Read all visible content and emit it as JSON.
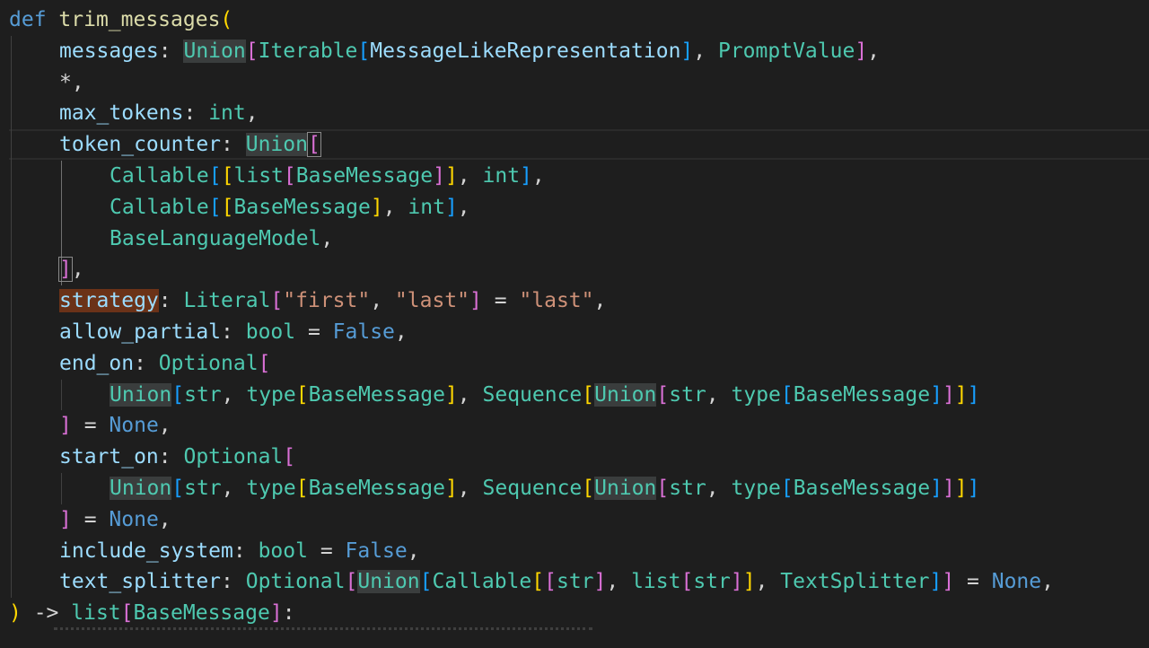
{
  "colors": {
    "background": "#1e1e1e",
    "default": "#d4d4d4",
    "keyword": "#569cd6",
    "function": "#dcdcaa",
    "param": "#9cdcfe",
    "type": "#4ec9b0",
    "string": "#ce9178",
    "bracket_yellow": "#ffd700",
    "bracket_pink": "#da70d6",
    "bracket_blue": "#179fff"
  },
  "code_lines": [
    {
      "indent": 0,
      "tokens": [
        {
          "t": "def",
          "c": "keyword"
        },
        {
          "t": " ",
          "c": "default"
        },
        {
          "t": "trim_messages",
          "c": "function"
        },
        {
          "t": "(",
          "c": "bracket_yellow"
        }
      ]
    },
    {
      "indent": 1,
      "tokens": [
        {
          "t": "messages",
          "c": "param"
        },
        {
          "t": ": ",
          "c": "default"
        },
        {
          "t": "Union",
          "c": "type",
          "hl": "hl"
        },
        {
          "t": "[",
          "c": "bracket_pink"
        },
        {
          "t": "Iterable",
          "c": "type"
        },
        {
          "t": "[",
          "c": "bracket_blue"
        },
        {
          "t": "MessageLikeRepresentation",
          "c": "param"
        },
        {
          "t": "]",
          "c": "bracket_blue"
        },
        {
          "t": ", ",
          "c": "default"
        },
        {
          "t": "PromptValue",
          "c": "type"
        },
        {
          "t": "]",
          "c": "bracket_pink"
        },
        {
          "t": ",",
          "c": "default"
        }
      ]
    },
    {
      "indent": 1,
      "tokens": [
        {
          "t": "*,",
          "c": "default"
        }
      ]
    },
    {
      "indent": 1,
      "tokens": [
        {
          "t": "max_tokens",
          "c": "param"
        },
        {
          "t": ": ",
          "c": "default"
        },
        {
          "t": "int",
          "c": "type"
        },
        {
          "t": ",",
          "c": "default"
        }
      ]
    },
    {
      "indent": 1,
      "tokens": [
        {
          "t": "token_counter",
          "c": "param"
        },
        {
          "t": ": ",
          "c": "default"
        },
        {
          "t": "Union",
          "c": "type",
          "hl": "hl"
        },
        {
          "t": "[",
          "c": "bracket_pink",
          "hl": "bracket-match"
        }
      ]
    },
    {
      "indent": 2,
      "tokens": [
        {
          "t": "Callable",
          "c": "type"
        },
        {
          "t": "[",
          "c": "bracket_blue"
        },
        {
          "t": "[",
          "c": "bracket_yellow"
        },
        {
          "t": "list",
          "c": "type"
        },
        {
          "t": "[",
          "c": "bracket_pink"
        },
        {
          "t": "BaseMessage",
          "c": "type"
        },
        {
          "t": "]",
          "c": "bracket_pink"
        },
        {
          "t": "]",
          "c": "bracket_yellow"
        },
        {
          "t": ", ",
          "c": "default"
        },
        {
          "t": "int",
          "c": "type"
        },
        {
          "t": "]",
          "c": "bracket_blue"
        },
        {
          "t": ",",
          "c": "default"
        }
      ]
    },
    {
      "indent": 2,
      "tokens": [
        {
          "t": "Callable",
          "c": "type"
        },
        {
          "t": "[",
          "c": "bracket_blue"
        },
        {
          "t": "[",
          "c": "bracket_yellow"
        },
        {
          "t": "BaseMessage",
          "c": "type"
        },
        {
          "t": "]",
          "c": "bracket_yellow"
        },
        {
          "t": ", ",
          "c": "default"
        },
        {
          "t": "int",
          "c": "type"
        },
        {
          "t": "]",
          "c": "bracket_blue"
        },
        {
          "t": ",",
          "c": "default"
        }
      ]
    },
    {
      "indent": 2,
      "tokens": [
        {
          "t": "BaseLanguageModel",
          "c": "type"
        },
        {
          "t": ",",
          "c": "default"
        }
      ]
    },
    {
      "indent": 1,
      "tokens": [
        {
          "t": "]",
          "c": "bracket_pink",
          "hl": "bracket-match"
        },
        {
          "t": ",",
          "c": "default"
        }
      ]
    },
    {
      "indent": 1,
      "tokens": [
        {
          "t": "strategy",
          "c": "param",
          "hl": "hl-warn"
        },
        {
          "t": ": ",
          "c": "default"
        },
        {
          "t": "Literal",
          "c": "type"
        },
        {
          "t": "[",
          "c": "bracket_pink"
        },
        {
          "t": "\"first\"",
          "c": "string"
        },
        {
          "t": ", ",
          "c": "default"
        },
        {
          "t": "\"last\"",
          "c": "string"
        },
        {
          "t": "]",
          "c": "bracket_pink"
        },
        {
          "t": " = ",
          "c": "default"
        },
        {
          "t": "\"last\"",
          "c": "string"
        },
        {
          "t": ",",
          "c": "default"
        }
      ]
    },
    {
      "indent": 1,
      "tokens": [
        {
          "t": "allow_partial",
          "c": "param"
        },
        {
          "t": ": ",
          "c": "default"
        },
        {
          "t": "bool",
          "c": "type"
        },
        {
          "t": " = ",
          "c": "default"
        },
        {
          "t": "False",
          "c": "keyword"
        },
        {
          "t": ",",
          "c": "default"
        }
      ]
    },
    {
      "indent": 1,
      "tokens": [
        {
          "t": "end_on",
          "c": "param"
        },
        {
          "t": ": ",
          "c": "default"
        },
        {
          "t": "Optional",
          "c": "type"
        },
        {
          "t": "[",
          "c": "bracket_pink"
        }
      ]
    },
    {
      "indent": 2,
      "tokens": [
        {
          "t": "Union",
          "c": "type",
          "hl": "hl"
        },
        {
          "t": "[",
          "c": "bracket_blue"
        },
        {
          "t": "str",
          "c": "type"
        },
        {
          "t": ", ",
          "c": "default"
        },
        {
          "t": "type",
          "c": "type"
        },
        {
          "t": "[",
          "c": "bracket_yellow"
        },
        {
          "t": "BaseMessage",
          "c": "type"
        },
        {
          "t": "]",
          "c": "bracket_yellow"
        },
        {
          "t": ", ",
          "c": "default"
        },
        {
          "t": "Sequence",
          "c": "type"
        },
        {
          "t": "[",
          "c": "bracket_yellow"
        },
        {
          "t": "Union",
          "c": "type",
          "hl": "hl"
        },
        {
          "t": "[",
          "c": "bracket_pink"
        },
        {
          "t": "str",
          "c": "type"
        },
        {
          "t": ", ",
          "c": "default"
        },
        {
          "t": "type",
          "c": "type"
        },
        {
          "t": "[",
          "c": "bracket_blue"
        },
        {
          "t": "BaseMessage",
          "c": "type"
        },
        {
          "t": "]",
          "c": "bracket_blue"
        },
        {
          "t": "]",
          "c": "bracket_pink"
        },
        {
          "t": "]",
          "c": "bracket_yellow"
        },
        {
          "t": "]",
          "c": "bracket_blue"
        }
      ]
    },
    {
      "indent": 1,
      "tokens": [
        {
          "t": "]",
          "c": "bracket_pink"
        },
        {
          "t": " = ",
          "c": "default"
        },
        {
          "t": "None",
          "c": "keyword"
        },
        {
          "t": ",",
          "c": "default"
        }
      ]
    },
    {
      "indent": 1,
      "tokens": [
        {
          "t": "start_on",
          "c": "param"
        },
        {
          "t": ": ",
          "c": "default"
        },
        {
          "t": "Optional",
          "c": "type"
        },
        {
          "t": "[",
          "c": "bracket_pink"
        }
      ]
    },
    {
      "indent": 2,
      "tokens": [
        {
          "t": "Union",
          "c": "type",
          "hl": "hl"
        },
        {
          "t": "[",
          "c": "bracket_blue"
        },
        {
          "t": "str",
          "c": "type"
        },
        {
          "t": ", ",
          "c": "default"
        },
        {
          "t": "type",
          "c": "type"
        },
        {
          "t": "[",
          "c": "bracket_yellow"
        },
        {
          "t": "BaseMessage",
          "c": "type"
        },
        {
          "t": "]",
          "c": "bracket_yellow"
        },
        {
          "t": ", ",
          "c": "default"
        },
        {
          "t": "Sequence",
          "c": "type"
        },
        {
          "t": "[",
          "c": "bracket_yellow"
        },
        {
          "t": "Union",
          "c": "type",
          "hl": "hl"
        },
        {
          "t": "[",
          "c": "bracket_pink"
        },
        {
          "t": "str",
          "c": "type"
        },
        {
          "t": ", ",
          "c": "default"
        },
        {
          "t": "type",
          "c": "type"
        },
        {
          "t": "[",
          "c": "bracket_blue"
        },
        {
          "t": "BaseMessage",
          "c": "type"
        },
        {
          "t": "]",
          "c": "bracket_blue"
        },
        {
          "t": "]",
          "c": "bracket_pink"
        },
        {
          "t": "]",
          "c": "bracket_yellow"
        },
        {
          "t": "]",
          "c": "bracket_blue"
        }
      ]
    },
    {
      "indent": 1,
      "tokens": [
        {
          "t": "]",
          "c": "bracket_pink"
        },
        {
          "t": " = ",
          "c": "default"
        },
        {
          "t": "None",
          "c": "keyword"
        },
        {
          "t": ",",
          "c": "default"
        }
      ]
    },
    {
      "indent": 1,
      "tokens": [
        {
          "t": "include_system",
          "c": "param"
        },
        {
          "t": ": ",
          "c": "default"
        },
        {
          "t": "bool",
          "c": "type"
        },
        {
          "t": " = ",
          "c": "default"
        },
        {
          "t": "False",
          "c": "keyword"
        },
        {
          "t": ",",
          "c": "default"
        }
      ]
    },
    {
      "indent": 1,
      "tokens": [
        {
          "t": "text_splitter",
          "c": "param"
        },
        {
          "t": ": ",
          "c": "default"
        },
        {
          "t": "Optional",
          "c": "type"
        },
        {
          "t": "[",
          "c": "bracket_pink"
        },
        {
          "t": "Union",
          "c": "type",
          "hl": "hl"
        },
        {
          "t": "[",
          "c": "bracket_blue"
        },
        {
          "t": "Callable",
          "c": "type"
        },
        {
          "t": "[",
          "c": "bracket_yellow"
        },
        {
          "t": "[",
          "c": "bracket_pink"
        },
        {
          "t": "str",
          "c": "type"
        },
        {
          "t": "]",
          "c": "bracket_pink"
        },
        {
          "t": ", ",
          "c": "default"
        },
        {
          "t": "list",
          "c": "type"
        },
        {
          "t": "[",
          "c": "bracket_pink"
        },
        {
          "t": "str",
          "c": "type"
        },
        {
          "t": "]",
          "c": "bracket_pink"
        },
        {
          "t": "]",
          "c": "bracket_yellow"
        },
        {
          "t": ", ",
          "c": "default"
        },
        {
          "t": "TextSplitter",
          "c": "type"
        },
        {
          "t": "]",
          "c": "bracket_blue"
        },
        {
          "t": "]",
          "c": "bracket_pink"
        },
        {
          "t": " = ",
          "c": "default"
        },
        {
          "t": "None",
          "c": "keyword"
        },
        {
          "t": ",",
          "c": "default"
        }
      ]
    },
    {
      "indent": 0,
      "tokens": [
        {
          "t": ")",
          "c": "bracket_yellow"
        },
        {
          "t": " -> ",
          "c": "default"
        },
        {
          "t": "list",
          "c": "type"
        },
        {
          "t": "[",
          "c": "bracket_pink"
        },
        {
          "t": "BaseMessage",
          "c": "type"
        },
        {
          "t": "]",
          "c": "bracket_pink"
        },
        {
          "t": ":",
          "c": "default"
        }
      ]
    }
  ]
}
